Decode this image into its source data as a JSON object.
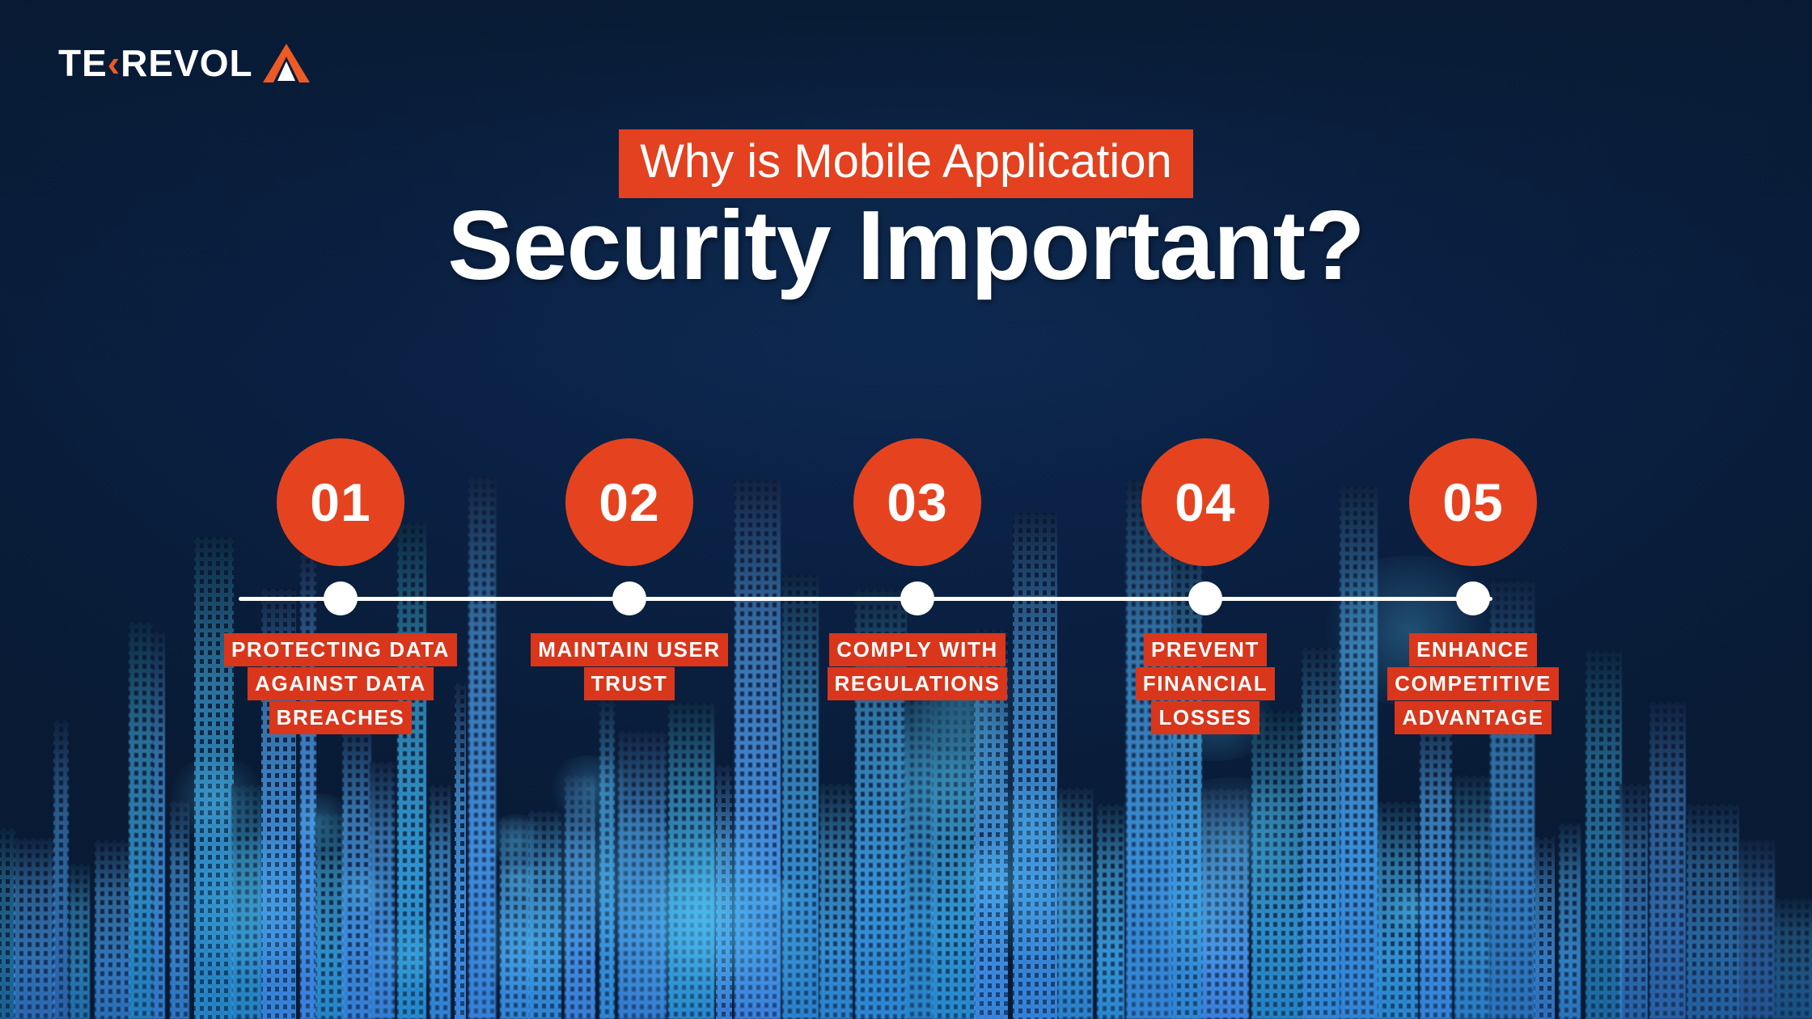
{
  "brand": {
    "logo_text_1": "TE",
    "logo_chevron": "‹",
    "logo_text_2": "REVOL",
    "logo_mark": "triangle-arrow-logo-mark"
  },
  "colors": {
    "background_navy": "#081A33",
    "background_navy_light": "#10305C",
    "accent_orange": "#E5431F",
    "eyebrow_orange": "#E3411F",
    "label_red": "#D9361B",
    "white": "#FFFFFF",
    "city_cyan": "#6ED7FF"
  },
  "heading": {
    "eyebrow": "Why is Mobile Application",
    "headline": "Security Important?"
  },
  "timeline": {
    "line_color": "#FFFFFF",
    "steps": [
      {
        "number": "01",
        "label_lines": [
          "PROTECTING DATA",
          "AGAINST DATA",
          "BREACHES"
        ]
      },
      {
        "number": "02",
        "label_lines": [
          "MAINTAIN USER",
          "TRUST"
        ]
      },
      {
        "number": "03",
        "label_lines": [
          "COMPLY WITH",
          "REGULATIONS"
        ]
      },
      {
        "number": "04",
        "label_lines": [
          "PREVENT",
          "FINANCIAL",
          "LOSSES"
        ]
      },
      {
        "number": "05",
        "label_lines": [
          "ENHANCE",
          "COMPETITIVE",
          "ADVANTAGE"
        ]
      }
    ]
  }
}
